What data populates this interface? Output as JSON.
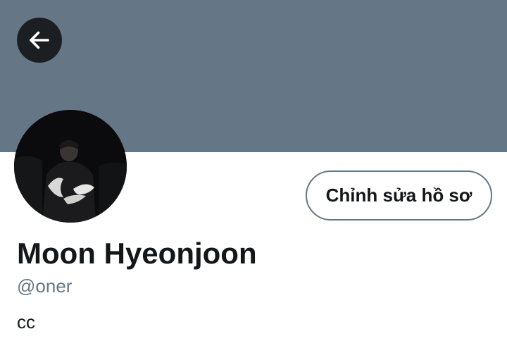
{
  "profile": {
    "display_name": "Moon Hyeonjoon",
    "handle": "@oner",
    "bio": "cc"
  },
  "actions": {
    "edit_profile_label": "Chỉnh sửa hồ sơ"
  },
  "icons": {
    "back": "arrow-left-icon"
  },
  "colors": {
    "banner": "#657786",
    "back_button_bg": "#1c1f22",
    "text_primary": "#14171a",
    "text_secondary": "#657786"
  }
}
